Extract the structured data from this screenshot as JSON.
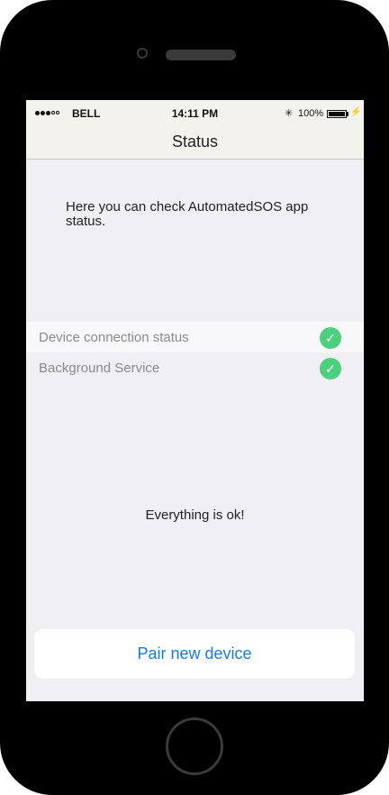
{
  "status_bar": {
    "carrier": "BELL",
    "time": "14:11 PM",
    "bluetooth_icon": "bluetooth-icon",
    "battery_percent": "100%"
  },
  "nav": {
    "title": "Status"
  },
  "intro_text": "Here you can check AutomatedSOS app status.",
  "status_items": [
    {
      "label": "Device connection status",
      "ok": true,
      "icon": "checkmark-icon"
    },
    {
      "label": "Background Service",
      "ok": true,
      "icon": "checkmark-icon"
    }
  ],
  "summary": "Everything is ok!",
  "pair_button_label": "Pair new device",
  "colors": {
    "accent": "#1a7be0",
    "success": "#4cd07e",
    "background": "#efeff4",
    "bar": "#f4f2ed"
  }
}
